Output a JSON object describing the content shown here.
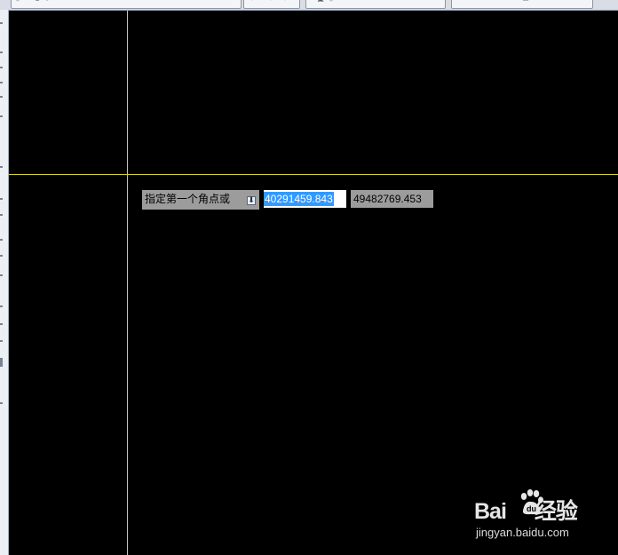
{
  "command_prompt": {
    "label": "指定第一个角点或",
    "dropdown_icon": "dropdown-arrow-icon"
  },
  "coordinates": {
    "x_value": "40291459.843",
    "y_value": "49482769.453"
  },
  "watermark": {
    "logo_text_left": "Bai",
    "logo_text_right": "经验",
    "site": "jingyan.baidu.com"
  },
  "colors": {
    "canvas_background": "#000000",
    "crosshair": "#d8d23a",
    "selection": "#3399ff",
    "tooltip_background": "#9c9c9c"
  }
}
